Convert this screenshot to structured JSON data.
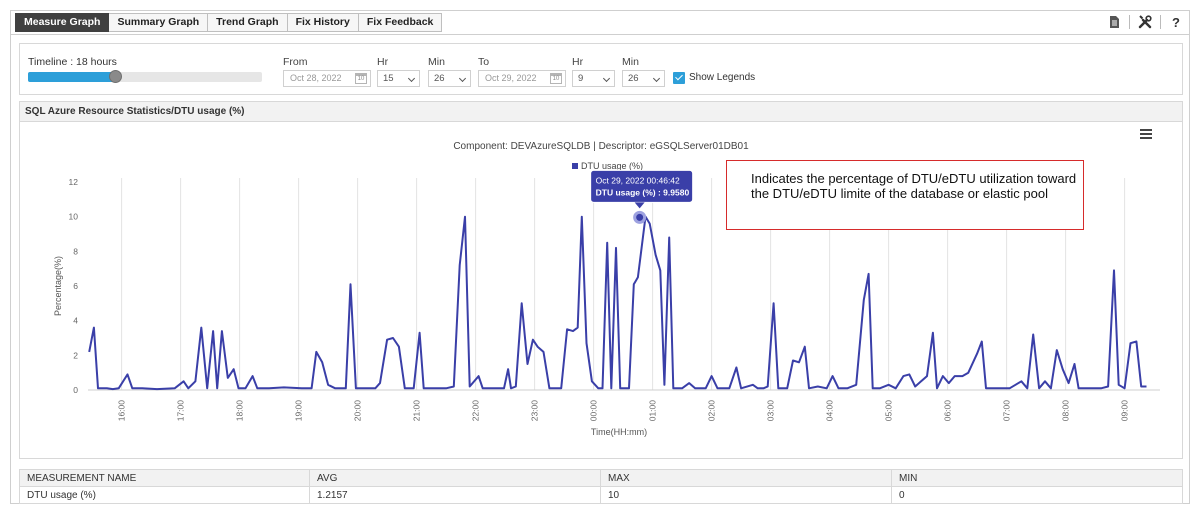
{
  "tabs": [
    {
      "label": "Measure Graph",
      "active": true
    },
    {
      "label": "Summary Graph",
      "active": false
    },
    {
      "label": "Trend Graph",
      "active": false
    },
    {
      "label": "Fix History",
      "active": false
    },
    {
      "label": "Fix Feedback",
      "active": false
    }
  ],
  "toolbar": {
    "help_label": "?",
    "icons": [
      "report-icon",
      "tools-icon",
      "help-icon"
    ]
  },
  "filters": {
    "timeline_label": "Timeline : 18 hours",
    "timeline_fraction": 0.37,
    "from_label": "From",
    "from_date": "Oct 28, 2022",
    "from_hr_label": "Hr",
    "from_hr": "15",
    "from_min_label": "Min",
    "from_min": "26",
    "to_label": "To",
    "to_date": "Oct 29, 2022",
    "to_hr_label": "Hr",
    "to_hr": "9",
    "to_min_label": "Min",
    "to_min": "26",
    "show_legends_label": "Show Legends",
    "show_legends_checked": true,
    "calendar_icon_text": "10"
  },
  "panel": {
    "title": "SQL Azure Resource Statistics/DTU usage (%)"
  },
  "callout": {
    "text": "Indicates the percentage of DTU/eDTU utilization toward the DTU/eDTU limite of the database or elastic pool"
  },
  "colors": {
    "series": "#3a3fa8",
    "accent": "#2d9fd9",
    "callout_border": "#d62b2b",
    "tab_active": "#404040"
  },
  "chart_data": {
    "type": "line",
    "title": "Component: DEVAzureSQLDB | Descriptor: eGSQLServer01DB01",
    "xlabel": "Time(HH:mm)",
    "ylabel": "Percentage(%)",
    "ylim": [
      0,
      12
    ],
    "yticks": [
      "0",
      "2",
      "4",
      "6",
      "8",
      "10",
      "12"
    ],
    "xlim": [
      15.43,
      9.43
    ],
    "xticks": [
      {
        "t": 16,
        "label": "16:00"
      },
      {
        "t": 17,
        "label": "17:00"
      },
      {
        "t": 18,
        "label": "18:00"
      },
      {
        "t": 19,
        "label": "19:00"
      },
      {
        "t": 20,
        "label": "20:00"
      },
      {
        "t": 21,
        "label": "21:00"
      },
      {
        "t": 22,
        "label": "22:00"
      },
      {
        "t": 23,
        "label": "23:00"
      },
      {
        "t": 24,
        "label": "00:00"
      },
      {
        "t": 25,
        "label": "01:00"
      },
      {
        "t": 26,
        "label": "02:00"
      },
      {
        "t": 27,
        "label": "03:00"
      },
      {
        "t": 28,
        "label": "04:00"
      },
      {
        "t": 29,
        "label": "05:00"
      },
      {
        "t": 30,
        "label": "06:00"
      },
      {
        "t": 31,
        "label": "07:00"
      },
      {
        "t": 32,
        "label": "08:00"
      },
      {
        "t": 33,
        "label": "09:00"
      }
    ],
    "grid": "vertical",
    "legend": {
      "position": "top-center",
      "entries": [
        "DTU usage (%)"
      ]
    },
    "tooltip": {
      "line1": "Oct 29, 2022 00:46:42",
      "line2": "DTU usage (%) : 9.9580",
      "t": 24.78,
      "y": 9.958
    },
    "series": [
      {
        "name": "DTU usage (%)",
        "points": [
          [
            15.45,
            2.2
          ],
          [
            15.53,
            3.6
          ],
          [
            15.6,
            0.1
          ],
          [
            15.75,
            0.1
          ],
          [
            15.85,
            0.05
          ],
          [
            15.95,
            0.1
          ],
          [
            16.1,
            0.9
          ],
          [
            16.18,
            0.1
          ],
          [
            16.35,
            0.1
          ],
          [
            16.6,
            0.05
          ],
          [
            16.9,
            0.1
          ],
          [
            17.05,
            0.5
          ],
          [
            17.13,
            0.1
          ],
          [
            17.25,
            0.5
          ],
          [
            17.35,
            3.6
          ],
          [
            17.45,
            0.1
          ],
          [
            17.55,
            3.4
          ],
          [
            17.62,
            0.1
          ],
          [
            17.7,
            3.4
          ],
          [
            17.8,
            0.7
          ],
          [
            17.9,
            1.2
          ],
          [
            17.98,
            0.1
          ],
          [
            18.1,
            0.1
          ],
          [
            18.22,
            0.8
          ],
          [
            18.3,
            0.1
          ],
          [
            18.5,
            0.1
          ],
          [
            18.75,
            0.15
          ],
          [
            19.05,
            0.1
          ],
          [
            19.22,
            0.1
          ],
          [
            19.3,
            2.2
          ],
          [
            19.4,
            1.6
          ],
          [
            19.5,
            0.3
          ],
          [
            19.62,
            0.1
          ],
          [
            19.8,
            0.1
          ],
          [
            19.88,
            6.1
          ],
          [
            19.97,
            0.1
          ],
          [
            20.1,
            0.1
          ],
          [
            20.3,
            0.1
          ],
          [
            20.38,
            0.4
          ],
          [
            20.5,
            2.9
          ],
          [
            20.6,
            3.0
          ],
          [
            20.7,
            2.5
          ],
          [
            20.8,
            0.1
          ],
          [
            20.95,
            0.1
          ],
          [
            21.05,
            3.3
          ],
          [
            21.12,
            0.1
          ],
          [
            21.3,
            0.1
          ],
          [
            21.5,
            0.1
          ],
          [
            21.63,
            0.2
          ],
          [
            21.73,
            7.2
          ],
          [
            21.82,
            10.0
          ],
          [
            21.9,
            0.2
          ],
          [
            22.05,
            0.8
          ],
          [
            22.12,
            0.1
          ],
          [
            22.3,
            0.1
          ],
          [
            22.48,
            0.1
          ],
          [
            22.55,
            1.2
          ],
          [
            22.6,
            0.1
          ],
          [
            22.68,
            0.2
          ],
          [
            22.78,
            5.0
          ],
          [
            22.88,
            1.5
          ],
          [
            22.97,
            2.9
          ],
          [
            23.05,
            2.5
          ],
          [
            23.15,
            2.2
          ],
          [
            23.25,
            0.1
          ],
          [
            23.45,
            0.1
          ],
          [
            23.55,
            3.5
          ],
          [
            23.65,
            3.4
          ],
          [
            23.73,
            3.6
          ],
          [
            23.8,
            10.0
          ],
          [
            23.88,
            2.7
          ],
          [
            23.97,
            0.5
          ],
          [
            24.08,
            0.1
          ],
          [
            24.15,
            0.1
          ],
          [
            24.23,
            8.5
          ],
          [
            24.3,
            0.1
          ],
          [
            24.38,
            8.2
          ],
          [
            24.45,
            0.1
          ],
          [
            24.6,
            0.1
          ],
          [
            24.68,
            6.1
          ],
          [
            24.75,
            6.5
          ],
          [
            24.88,
            10.0
          ],
          [
            24.95,
            9.6
          ],
          [
            25.05,
            7.8
          ],
          [
            25.13,
            6.9
          ],
          [
            25.2,
            0.3
          ],
          [
            25.28,
            8.8
          ],
          [
            25.35,
            0.1
          ],
          [
            25.5,
            0.1
          ],
          [
            25.62,
            0.4
          ],
          [
            25.72,
            0.1
          ],
          [
            25.9,
            0.1
          ],
          [
            26.0,
            0.8
          ],
          [
            26.1,
            0.1
          ],
          [
            26.3,
            0.1
          ],
          [
            26.42,
            1.3
          ],
          [
            26.5,
            0.1
          ],
          [
            26.7,
            0.3
          ],
          [
            26.78,
            0.1
          ],
          [
            26.88,
            0.1
          ],
          [
            26.95,
            0.2
          ],
          [
            27.05,
            5.0
          ],
          [
            27.13,
            0.1
          ],
          [
            27.28,
            0.1
          ],
          [
            27.38,
            1.7
          ],
          [
            27.48,
            1.6
          ],
          [
            27.58,
            2.5
          ],
          [
            27.65,
            0.1
          ],
          [
            27.8,
            0.2
          ],
          [
            27.95,
            0.1
          ],
          [
            28.05,
            0.8
          ],
          [
            28.15,
            0.1
          ],
          [
            28.3,
            0.1
          ],
          [
            28.45,
            0.3
          ],
          [
            28.58,
            5.2
          ],
          [
            28.66,
            6.7
          ],
          [
            28.73,
            0.1
          ],
          [
            28.85,
            0.1
          ],
          [
            29.0,
            0.3
          ],
          [
            29.12,
            0.1
          ],
          [
            29.25,
            0.8
          ],
          [
            29.35,
            0.9
          ],
          [
            29.45,
            0.2
          ],
          [
            29.55,
            0.5
          ],
          [
            29.65,
            0.8
          ],
          [
            29.75,
            3.3
          ],
          [
            29.82,
            0.1
          ],
          [
            29.92,
            0.8
          ],
          [
            30.02,
            0.4
          ],
          [
            30.12,
            0.8
          ],
          [
            30.25,
            0.8
          ],
          [
            30.35,
            1.0
          ],
          [
            30.5,
            2.1
          ],
          [
            30.58,
            2.8
          ],
          [
            30.65,
            0.1
          ],
          [
            30.85,
            0.1
          ],
          [
            31.05,
            0.1
          ],
          [
            31.15,
            0.3
          ],
          [
            31.25,
            0.5
          ],
          [
            31.35,
            0.1
          ],
          [
            31.45,
            3.2
          ],
          [
            31.55,
            0.1
          ],
          [
            31.65,
            0.5
          ],
          [
            31.75,
            0.1
          ],
          [
            31.85,
            2.3
          ],
          [
            31.95,
            1.2
          ],
          [
            32.05,
            0.4
          ],
          [
            32.15,
            1.5
          ],
          [
            32.22,
            0.1
          ],
          [
            32.4,
            0.1
          ],
          [
            32.6,
            0.1
          ],
          [
            32.72,
            0.2
          ],
          [
            32.82,
            6.9
          ],
          [
            32.9,
            0.3
          ],
          [
            33.0,
            0.1
          ],
          [
            33.1,
            2.7
          ],
          [
            33.2,
            2.8
          ],
          [
            33.28,
            0.2
          ],
          [
            33.37,
            0.2
          ]
        ]
      }
    ]
  },
  "table": {
    "headers": [
      "MEASUREMENT NAME",
      "AVG",
      "MAX",
      "MIN"
    ],
    "rows": [
      [
        "DTU usage (%)",
        "1.2157",
        "10",
        "0"
      ]
    ]
  }
}
